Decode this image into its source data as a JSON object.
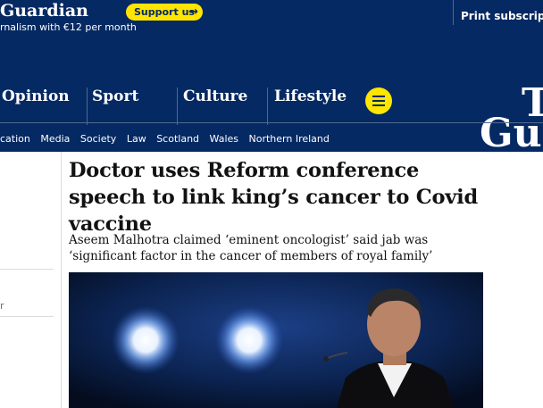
{
  "topbar": {
    "masthead_fragment": "Guardian",
    "support_text": "rnalism with €12 per month",
    "support_button": "Support us",
    "support_arrow": "→",
    "print_link": "Print subscripti"
  },
  "nav": {
    "pillars": [
      "Opinion",
      "Sport",
      "Culture",
      "Lifestyle"
    ],
    "logo_line1": "T",
    "logo_line2": "Gu",
    "subnav": [
      "cation",
      "Media",
      "Society",
      "Law",
      "Scotland",
      "Wales",
      "Northern Ireland"
    ]
  },
  "article": {
    "headline": "Doctor uses Reform conference speech to link king’s cancer to Covid vaccine",
    "standfirst": "Aseem Malhotra claimed ‘eminent oncologist’ said jab was ‘significant factor in the cancer of members of royal family’"
  },
  "left_column": {
    "fragment": "r"
  },
  "colors": {
    "brand": "#052962",
    "accent": "#ffe500",
    "text": "#121212"
  },
  "icons": {
    "menu": "menu-icon",
    "arrow": "arrow-right-icon"
  }
}
